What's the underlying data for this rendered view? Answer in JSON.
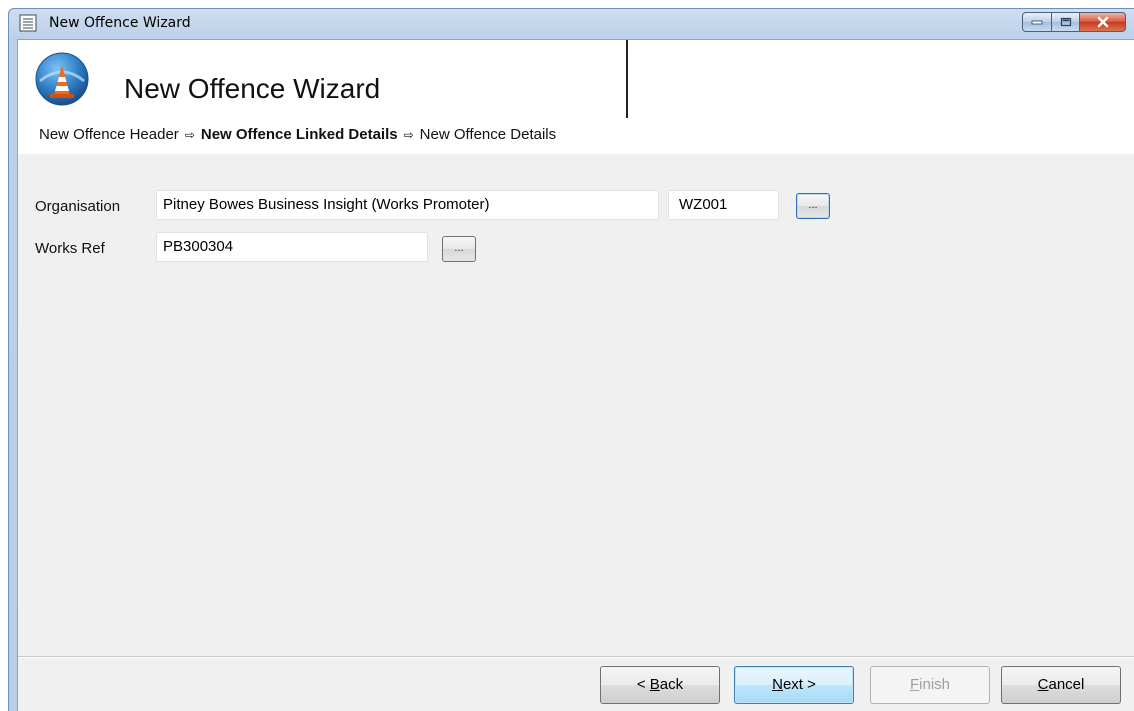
{
  "window": {
    "title": "New Offence Wizard"
  },
  "header": {
    "title": "New Offence Wizard"
  },
  "breadcrumb": {
    "steps": [
      "New Offence Header",
      "New Offence Linked Details",
      "New Offence Details"
    ],
    "separator": "⇨",
    "active_index": 1
  },
  "form": {
    "organisation_label": "Organisation",
    "organisation_value": "Pitney Bowes Business Insight (Works Promoter)",
    "organisation_code": "WZ001",
    "works_ref_label": "Works Ref",
    "works_ref_value": "PB300304",
    "browse_label": "..."
  },
  "buttons": {
    "back_prefix": "< ",
    "back_u": "B",
    "back_rest": "ack",
    "next_u": "N",
    "next_rest": "ext >",
    "finish_u": "F",
    "finish_rest": "inish",
    "cancel_u": "C",
    "cancel_rest": "ancel"
  },
  "colors": {
    "accent": "#3c7fb1",
    "close": "#c43b1e"
  }
}
